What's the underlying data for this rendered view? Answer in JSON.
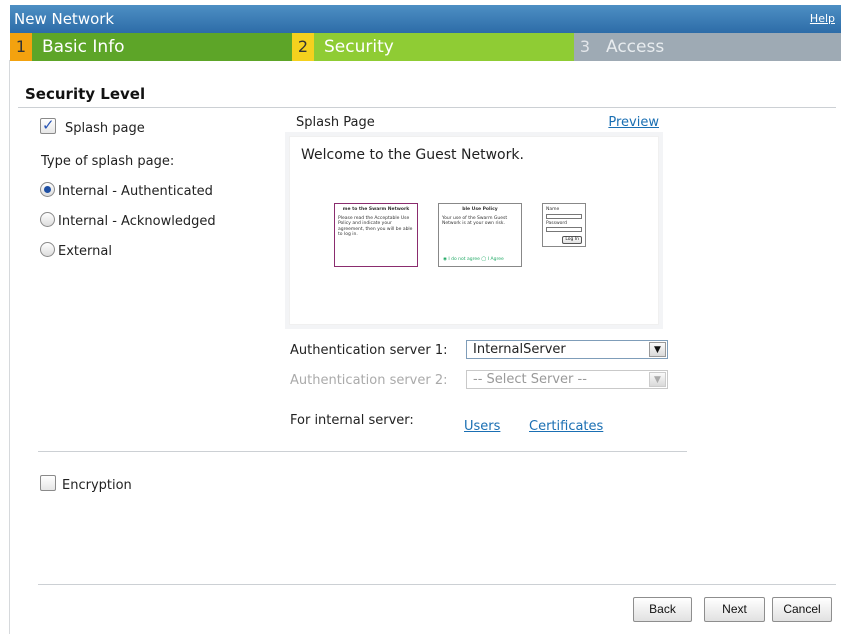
{
  "header": {
    "title": "New Network",
    "help_label": "Help"
  },
  "steps": [
    {
      "num": "1",
      "label": "Basic Info"
    },
    {
      "num": "2",
      "label": "Security"
    },
    {
      "num": "3",
      "label": "Access"
    }
  ],
  "security": {
    "section_title": "Security Level",
    "splash_page_label": "Splash page",
    "splash_page_checked": true,
    "type_label": "Type of splash page:",
    "options": [
      {
        "label": "Internal - Authenticated",
        "selected": true
      },
      {
        "label": "Internal - Acknowledged",
        "selected": false
      },
      {
        "label": "External",
        "selected": false
      }
    ]
  },
  "preview": {
    "label": "Splash Page",
    "link": "Preview",
    "welcome": "Welcome to the Guest Network.",
    "mini1_title": "me to the Swarm Network",
    "mini1_body": "Please read the Acceptable Use Policy and indicate your agreement, then you will be able to log in.",
    "mini2_title": "ble Use Policy",
    "mini2_body": "Your use of the Swarm Guest Network is at your own risk.",
    "mini2_radios": "◉ I do not agree   ◯ I Agree",
    "mini3_name": "Name",
    "mini3_password": "Password",
    "mini3_button": "Log In"
  },
  "auth": {
    "server1_label": "Authentication server 1:",
    "server1_value": "InternalServer",
    "server2_label": "Authentication server 2:",
    "server2_value": "-- Select Server --",
    "internal_label": "For internal server:",
    "users_link": "Users",
    "certificates_link": "Certificates"
  },
  "encryption": {
    "label": "Encryption",
    "checked": false
  },
  "buttons": {
    "back": "Back",
    "next": "Next",
    "cancel": "Cancel"
  }
}
